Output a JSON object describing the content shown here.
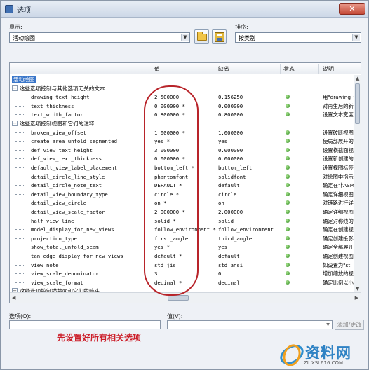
{
  "window": {
    "title": "选项",
    "close_glyph": "✕"
  },
  "toolbar": {
    "show_label": "显示:",
    "show_value": "活动绘图",
    "sort_label": "排序:",
    "sort_value": "按类别"
  },
  "table": {
    "headers": {
      "value": "值",
      "default": "缺省",
      "status": "状态",
      "description": "说明"
    },
    "rows": [
      {
        "kind": "category",
        "expander": "",
        "name": "活动绘图",
        "selected": true
      },
      {
        "kind": "category",
        "expander": "−",
        "name": "这些选项控制与其他选项无关的文本"
      },
      {
        "kind": "option",
        "name": "drawing_text_height",
        "value": "2.500000",
        "default": "0.156250",
        "desc": "用\"drawing_t"
      },
      {
        "kind": "option",
        "name": "text_thickness",
        "value": "0.000000 *",
        "default": "0.000000",
        "desc": "对再生后的新"
      },
      {
        "kind": "option",
        "name": "text_width_factor",
        "value": "0.800000 *",
        "default": "0.800000",
        "desc": "设置文本宽度"
      },
      {
        "kind": "category",
        "expander": "−",
        "name": "这些选项控制视图和它们的注释"
      },
      {
        "kind": "option",
        "name": "broken_view_offset",
        "value": "1.000000 *",
        "default": "1.000000",
        "desc": "设置破断视图"
      },
      {
        "kind": "option",
        "name": "create_area_unfold_segmented",
        "value": "yes *",
        "default": "yes",
        "desc": "使局部展开的"
      },
      {
        "kind": "option",
        "name": "def_view_text_height",
        "value": "3.000000",
        "default": "0.000000",
        "desc": "设置横截面视"
      },
      {
        "kind": "option",
        "name": "def_view_text_thickness",
        "value": "0.000000 *",
        "default": "0.000000",
        "desc": "设置新创建的"
      },
      {
        "kind": "option",
        "name": "default_view_label_placement",
        "value": "bottom_left *",
        "default": "bottom_left",
        "desc": "设置视图标签"
      },
      {
        "kind": "option",
        "name": "detail_circle_line_style",
        "value": "phantomfont",
        "default": "solidfont",
        "desc": "对绘图中指示"
      },
      {
        "kind": "option",
        "name": "detail_circle_note_text",
        "value": "DEFAULT *",
        "default": "default",
        "desc": "确定在非ASME"
      },
      {
        "kind": "option",
        "name": "detail_view_boundary_type",
        "value": "circle *",
        "default": "circle",
        "desc": "确定详细视图"
      },
      {
        "kind": "option",
        "name": "detail_view_circle",
        "value": "on *",
        "default": "on",
        "desc": "对链路进行详"
      },
      {
        "kind": "option",
        "name": "detail_view_scale_factor",
        "value": "2.000000 *",
        "default": "2.000000",
        "desc": "确定详细视图"
      },
      {
        "kind": "option",
        "name": "half_view_line",
        "value": "solid *",
        "default": "solid",
        "desc": "确定对称线的"
      },
      {
        "kind": "option",
        "name": "model_display_for_new_views",
        "value": "follow_environment *",
        "default": "follow_environment",
        "desc": "确定在创建视"
      },
      {
        "kind": "option",
        "name": "projection_type",
        "value": "first_angle",
        "default": "third_angle",
        "desc": "确定创建投影"
      },
      {
        "kind": "option",
        "name": "show_total_unfold_seam",
        "value": "yes *",
        "default": "yes",
        "desc": "确定全部展开"
      },
      {
        "kind": "option",
        "name": "tan_edge_display_for_new_views",
        "value": "default *",
        "default": "default",
        "desc": "确定创建视图"
      },
      {
        "kind": "option",
        "name": "view_note",
        "value": "std_jis",
        "default": "std_ansi",
        "desc": "如设置为\"st"
      },
      {
        "kind": "option",
        "name": "view_scale_denominator",
        "value": "3",
        "default": "0",
        "desc": "增加缩放的视"
      },
      {
        "kind": "option",
        "name": "view_scale_format",
        "value": "decimal *",
        "default": "decimal",
        "desc": "确定比例以小"
      },
      {
        "kind": "category",
        "expander": "−",
        "name": "这些选项控制横截面和它们的箭头"
      }
    ]
  },
  "bottom": {
    "option_label": "选项(O):",
    "value_label": "值(V):",
    "add_change_label": "添加/更改",
    "caption": "先设置好所有相关选项"
  },
  "watermark": {
    "text": "资料网",
    "url": "ZL.XSL616.COM"
  },
  "colors": {
    "annotation": "#b8242a",
    "selection": "#3a76c9",
    "status_ok": "#2f8a21"
  }
}
